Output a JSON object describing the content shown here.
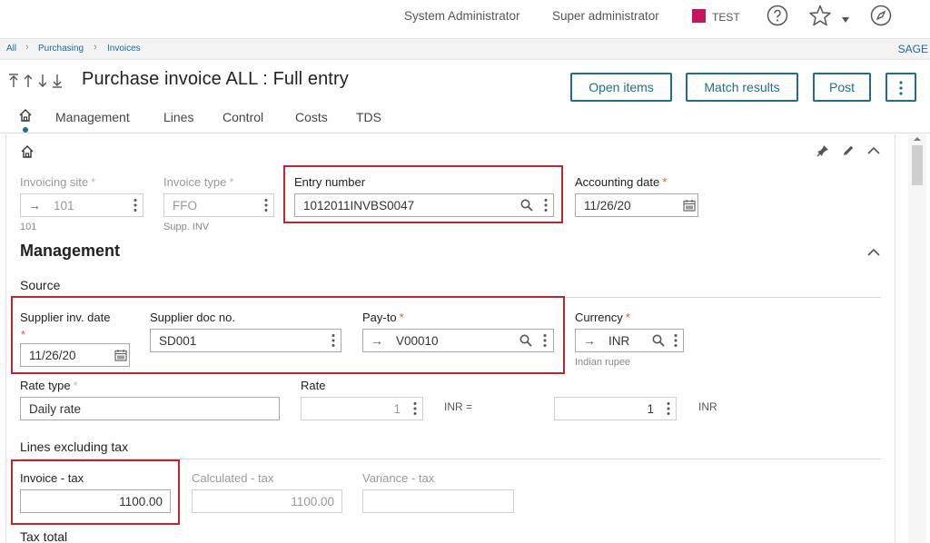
{
  "header": {
    "user_name": "System Administrator",
    "role": "Super administrator",
    "environment": "TEST",
    "env_color": "#c2185b"
  },
  "breadcrumb": {
    "items": [
      "All",
      "Purchasing",
      "Invoices"
    ],
    "company": "SAGE"
  },
  "title": "Purchase invoice ALL : Full entry",
  "actions": {
    "open_items": "Open items",
    "match_results": "Match results",
    "post": "Post"
  },
  "tabs": [
    "Management",
    "Lines",
    "Control",
    "Costs",
    "TDS"
  ],
  "header_fields": {
    "invoicing_site": {
      "label": "Invoicing site",
      "value": "101",
      "sub": "101"
    },
    "invoice_type": {
      "label": "Invoice type",
      "value": "FFO",
      "sub": "Supp. INV"
    },
    "entry_number": {
      "label": "Entry number",
      "value": "1012011INVBS0047"
    },
    "accounting_date": {
      "label": "Accounting date",
      "value": "11/26/20"
    }
  },
  "management": {
    "title": "Management",
    "source_title": "Source",
    "supplier_inv_date": {
      "label": "Supplier inv. date",
      "value": "11/26/20"
    },
    "supplier_doc_no": {
      "label": "Supplier doc no.",
      "value": "SD001"
    },
    "pay_to": {
      "label": "Pay-to",
      "value": "V00010"
    },
    "currency": {
      "label": "Currency",
      "value": "INR",
      "sub": "Indian rupee"
    },
    "rate_type": {
      "label": "Rate type",
      "value": "Daily rate"
    },
    "rate": {
      "label": "Rate",
      "value": "1",
      "unit_left": "INR =",
      "value2": "1",
      "unit_right": "INR"
    },
    "lines_title": "Lines excluding tax",
    "invoice_tax": {
      "label": "Invoice - tax",
      "value": "1100.00"
    },
    "calculated_tax": {
      "label": "Calculated - tax",
      "value": "1100.00"
    },
    "variance_tax": {
      "label": "Variance - tax",
      "value": ""
    },
    "tax_total_title": "Tax total"
  },
  "colors": {
    "accent": "#1f6f86",
    "link": "#1b6aa5",
    "highlight": "#c0272d",
    "required": "#e05a2b"
  }
}
